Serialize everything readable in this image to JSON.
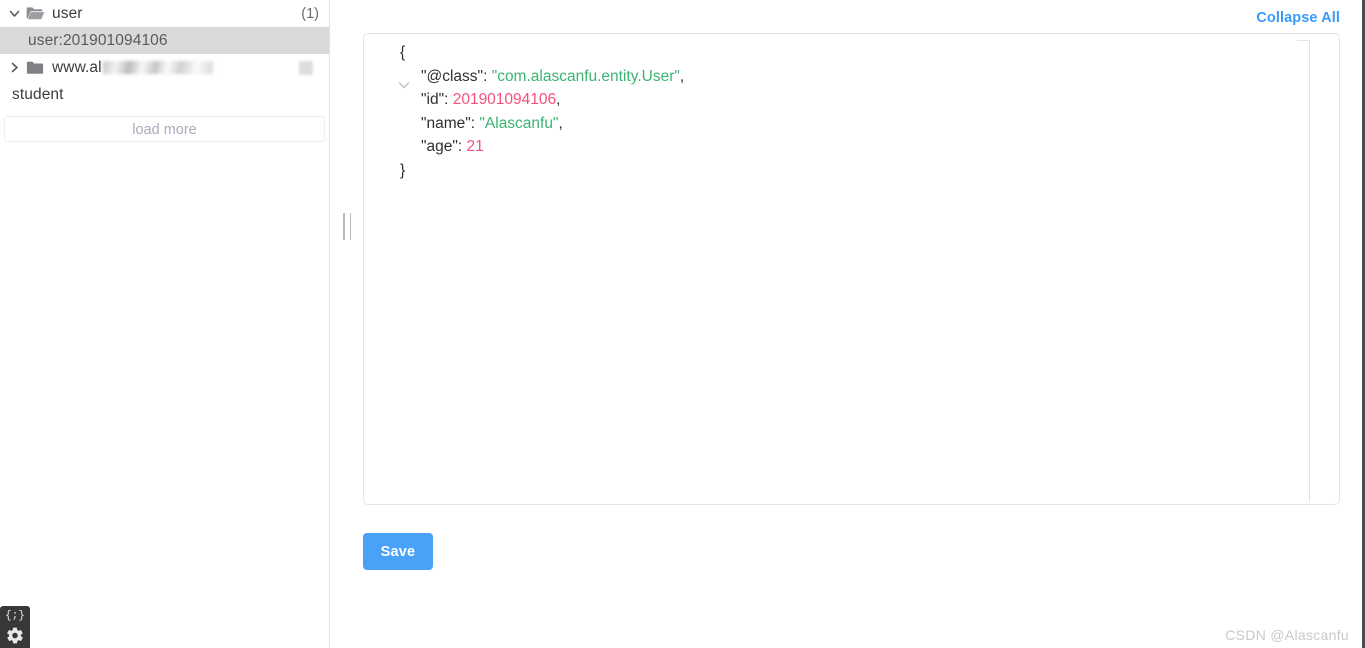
{
  "sidebar": {
    "tree": [
      {
        "label": "user",
        "type": "folder-open",
        "depth": 0,
        "twisty": "chevron-down",
        "count": "(1)",
        "selected": false,
        "redacted": false
      },
      {
        "label": "user:201901094106",
        "type": "leaf",
        "depth": 1,
        "twisty": "",
        "count": "",
        "selected": true,
        "redacted": false
      },
      {
        "label": "www.al",
        "type": "folder-closed",
        "depth": 0,
        "twisty": "chevron-right",
        "count": "",
        "selected": false,
        "redacted": true
      },
      {
        "label": "student",
        "type": "plain",
        "depth": 0,
        "twisty": "",
        "count": "",
        "selected": false,
        "redacted": false
      }
    ],
    "load_more_label": "load more"
  },
  "main": {
    "collapse_all_label": "Collapse All",
    "save_label": "Save",
    "json_lines": [
      {
        "indent": 0,
        "parts": [
          {
            "t": "{",
            "c": "punc"
          }
        ]
      },
      {
        "indent": 1,
        "parts": [
          {
            "t": "\"@class\"",
            "c": "key"
          },
          {
            "t": ": ",
            "c": "punc"
          },
          {
            "t": "\"com.alascanfu.entity.User\"",
            "c": "str"
          },
          {
            "t": ",",
            "c": "punc"
          }
        ]
      },
      {
        "indent": 1,
        "parts": [
          {
            "t": "\"id\"",
            "c": "key"
          },
          {
            "t": ": ",
            "c": "punc"
          },
          {
            "t": "201901094106",
            "c": "num"
          },
          {
            "t": ",",
            "c": "punc"
          }
        ]
      },
      {
        "indent": 1,
        "parts": [
          {
            "t": "\"name\"",
            "c": "key"
          },
          {
            "t": ": ",
            "c": "punc"
          },
          {
            "t": "\"Alascanfu\"",
            "c": "str"
          },
          {
            "t": ",",
            "c": "punc"
          }
        ]
      },
      {
        "indent": 1,
        "parts": [
          {
            "t": "\"age\"",
            "c": "key"
          },
          {
            "t": ": ",
            "c": "punc"
          },
          {
            "t": "21",
            "c": "num"
          }
        ]
      },
      {
        "indent": 0,
        "parts": [
          {
            "t": "}",
            "c": "punc"
          }
        ]
      }
    ]
  },
  "dev_widget": {
    "code_glyph": "{;}"
  },
  "watermark": "CSDN @Alascanfu",
  "colors": {
    "accent_blue": "#49a2f8",
    "link_blue": "#3a9bfd",
    "json_string": "#3cb371",
    "json_number": "#f4507d",
    "selection_gray": "#d9d9d9",
    "border_gray": "#e4e4e6"
  }
}
